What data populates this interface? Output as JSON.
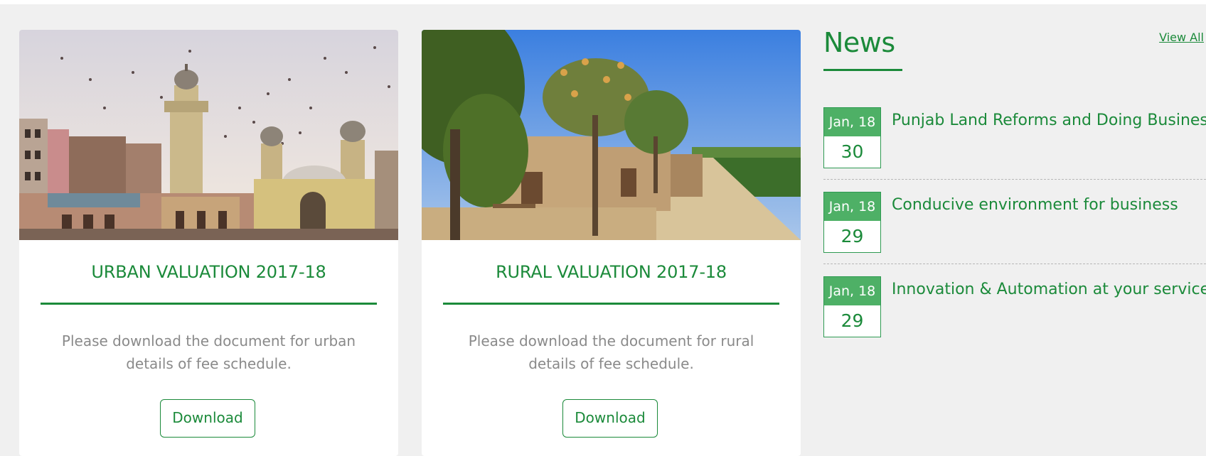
{
  "cards": [
    {
      "image": "mosque-photo",
      "title": "URBAN VALUATION 2017-18",
      "text": "Please download the document for urban details of fee schedule.",
      "button": "Download"
    },
    {
      "image": "village-road-photo",
      "title": "RURAL VALUATION 2017-18",
      "text": "Please download the document for rural details of fee schedule.",
      "button": "Download"
    }
  ],
  "news": {
    "title": "News",
    "view_all": "View All",
    "items": [
      {
        "month": "Jan, 18",
        "day": "30",
        "headline": "Punjab Land Reforms and Doing Business"
      },
      {
        "month": "Jan, 18",
        "day": "29",
        "headline": "Conducive environment for business"
      },
      {
        "month": "Jan, 18",
        "day": "29",
        "headline": "Innovation & Automation at your service"
      }
    ]
  },
  "colors": {
    "accent": "#1b8a3a",
    "date_header": "#4eb066",
    "background": "#f0f0f0"
  }
}
